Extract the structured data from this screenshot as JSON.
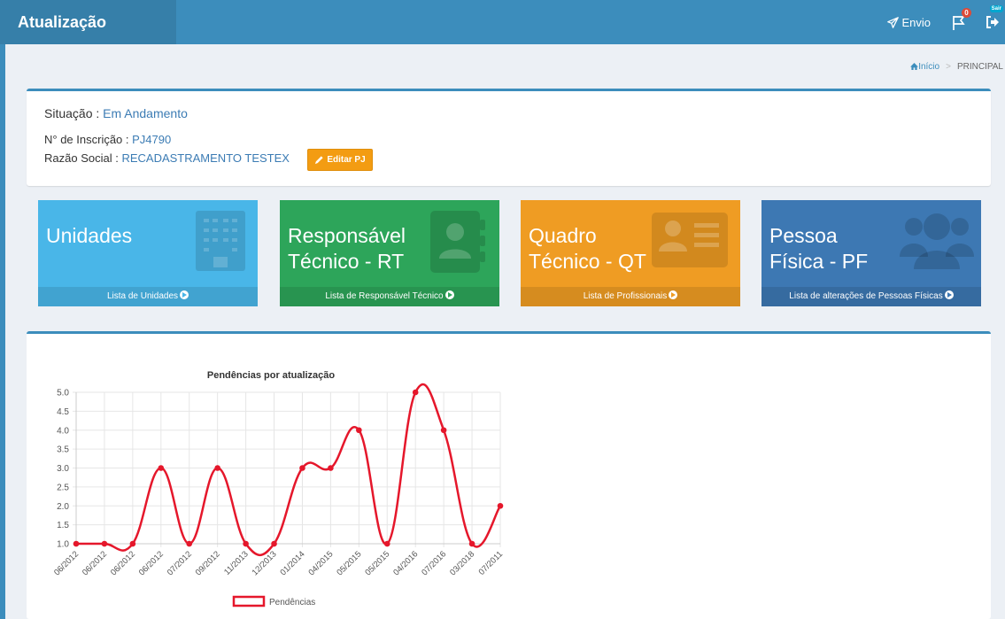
{
  "header": {
    "title": "Atualização",
    "envio_label": "Envio",
    "flag_badge": "0",
    "exit_badge": "Sair"
  },
  "breadcrumb": {
    "home": "Início",
    "current": "PRINCIPAL"
  },
  "info": {
    "situacao_label": "Situação :",
    "situacao_value": "Em Andamento",
    "inscricao_label": "N° de Inscrição :",
    "inscricao_value": "PJ4790",
    "razao_label": "Razão Social :",
    "razao_value": "RECADASTRAMENTO TESTEX",
    "edit_button": "Editar PJ"
  },
  "tiles": [
    {
      "title_line1": "Unidades",
      "title_line2": "",
      "link": "Lista de Unidades",
      "icon": "building-icon",
      "color": "#49b6e8"
    },
    {
      "title_line1": "Responsável",
      "title_line2": "Técnico - RT",
      "link": "Lista de Responsável Técnico",
      "icon": "contact-book-icon",
      "color": "#2da55a"
    },
    {
      "title_line1": "Quadro",
      "title_line2": "Técnico - QT",
      "link": "Lista de Profissionais",
      "icon": "id-card-icon",
      "color": "#ef9c23"
    },
    {
      "title_line1": "Pessoa",
      "title_line2": "Física - PF",
      "link": "Lista de alterações de Pessoas Físicas",
      "icon": "users-icon",
      "color": "#3d78b3"
    }
  ],
  "chart_data": {
    "type": "line",
    "title": "Pendências por atualização",
    "categories": [
      "06/2012",
      "06/2012",
      "06/2012",
      "06/2012",
      "07/2012",
      "09/2012",
      "11/2013",
      "12/2013",
      "01/2014",
      "04/2015",
      "05/2015",
      "05/2015",
      "04/2016",
      "07/2016",
      "03/2018",
      "07/2011"
    ],
    "series": [
      {
        "name": "Pendências",
        "values": [
          1,
          1,
          1,
          3,
          1,
          3,
          1,
          1,
          3,
          3,
          4,
          1,
          5,
          4,
          1,
          2
        ],
        "color": "#e5172b"
      }
    ],
    "ylim": [
      1.0,
      5.0
    ],
    "yticks": [
      "1.0",
      "1.5",
      "2.0",
      "2.5",
      "3.0",
      "3.5",
      "4.0",
      "4.5",
      "5.0"
    ],
    "grid": true,
    "legend": "bottom"
  }
}
